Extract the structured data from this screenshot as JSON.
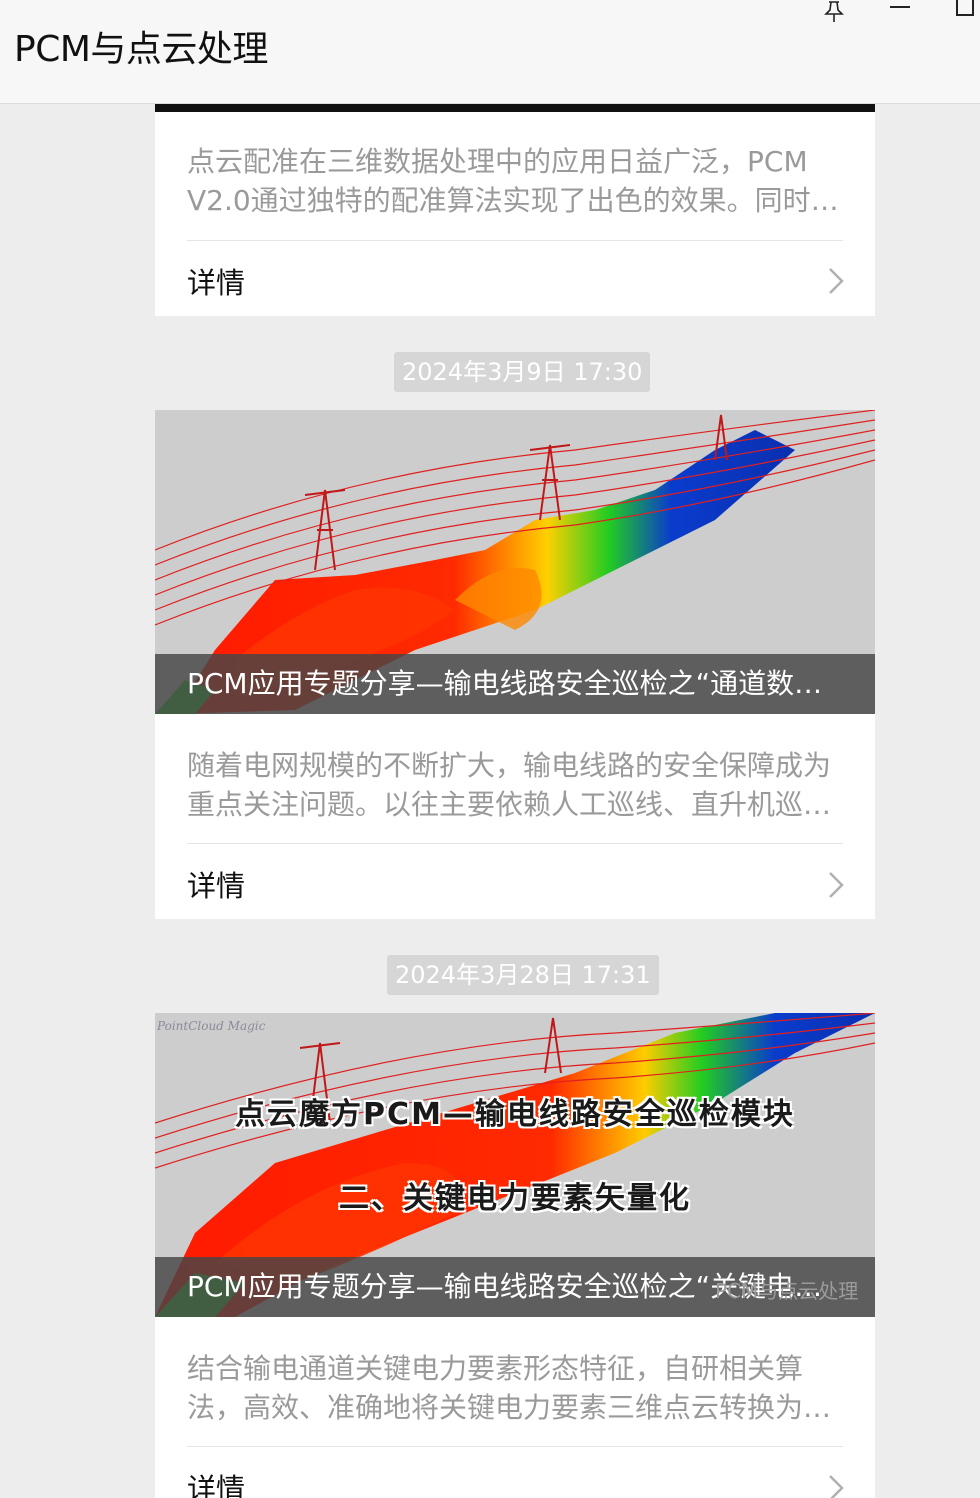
{
  "window": {
    "title": "PCM与点云处理"
  },
  "feed": {
    "detail_label": "详情",
    "items": [
      {
        "summary": "点云配准在三维数据处理中的应用日益广泛，PCM V2.0通过独特的配准算法实现了出色的效果。同时…"
      },
      {
        "timestamp": "2024年3月9日 17:30",
        "cover_title": "PCM应用专题分享—输电线路安全巡检之“通道数…",
        "summary": "随着电网规模的不断扩大，输电线路的安全保障成为重点关注问题。以往主要依赖人工巡线、直升机巡…"
      },
      {
        "timestamp": "2024年3月28日 17:31",
        "cover_title": "PCM应用专题分享—输电线路安全巡检之“关键电…",
        "cover_overlay_line1": "点云魔方PCM—输电线路安全巡检模块",
        "cover_overlay_line2": "二、关键电力要素矢量化",
        "cover_watermark": "PointCloud Magic",
        "cover_corner_mark": "PCM与点云处理",
        "summary": "结合输电通道关键电力要素形态特征，自研相关算法，高效、准确地将关键电力要素三维点云转换为…"
      }
    ]
  },
  "colors": {
    "background": "#ededed",
    "card": "#ffffff",
    "summary_text": "#9a9a9a",
    "timestamp_bg": "#d6d6d6"
  },
  "icons": [
    "pin-icon",
    "minimize-icon",
    "maximize-icon",
    "chevron-right-icon"
  ]
}
